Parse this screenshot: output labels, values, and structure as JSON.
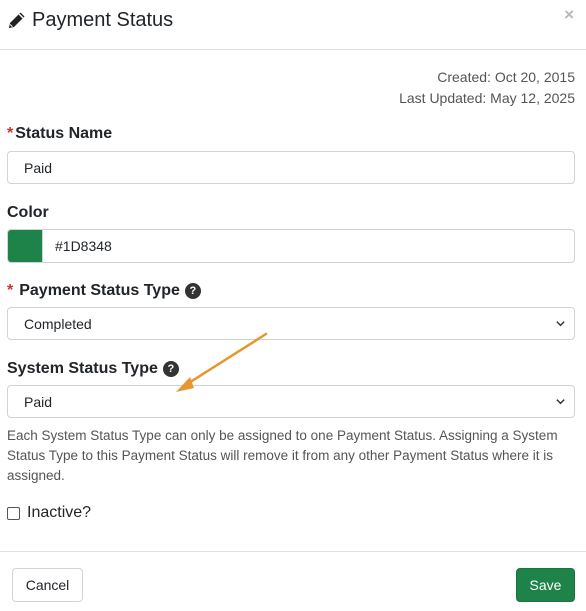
{
  "header": {
    "title": "Payment Status",
    "close_label": "×"
  },
  "meta": {
    "created": "Created: Oct 20, 2015",
    "updated": "Last Updated: May 12, 2025"
  },
  "form": {
    "status_name": {
      "label": "Status Name",
      "value": "Paid",
      "required_mark": "*"
    },
    "color": {
      "label": "Color",
      "value": "#1D8348",
      "swatch_color": "#1D8348"
    },
    "payment_status_type": {
      "label": "Payment Status Type",
      "value": "Completed",
      "required_mark": "*"
    },
    "system_status_type": {
      "label": "System Status Type",
      "value": "Paid"
    },
    "help_text": "Each System Status Type can only be assigned to one Payment Status. Assigning a System Status Type to this Payment Status will remove it from any other Payment Status where it is assigned.",
    "inactive_label": "Inactive?",
    "inactive_checked": false
  },
  "footer": {
    "cancel_label": "Cancel",
    "save_label": "Save"
  },
  "colors": {
    "accent": "#1D8348",
    "annotation_arrow": "#E8962E"
  }
}
